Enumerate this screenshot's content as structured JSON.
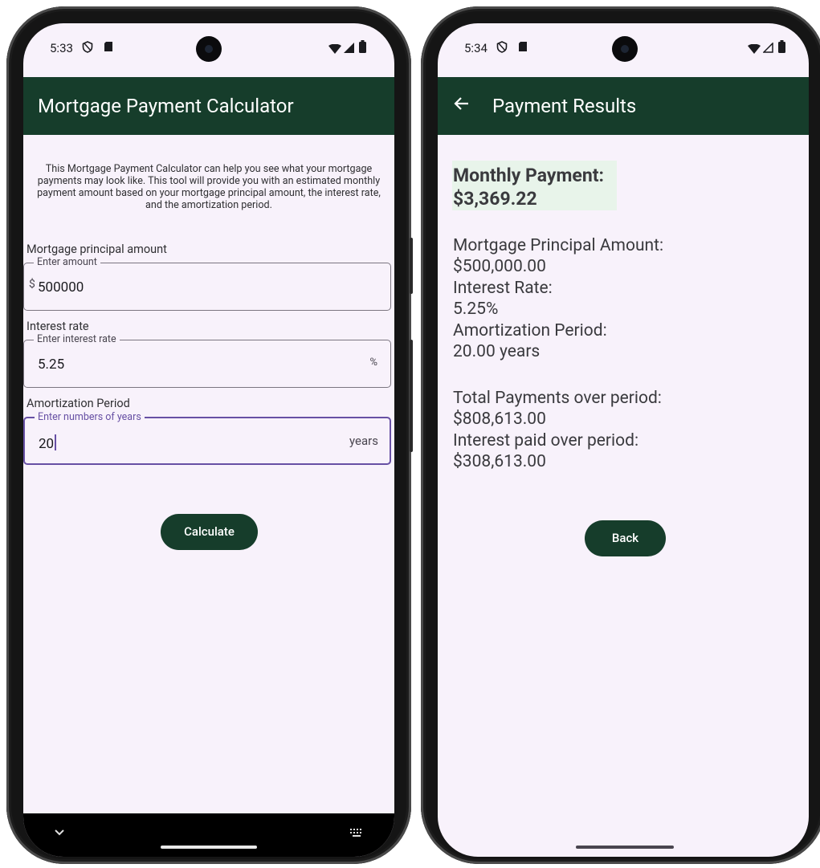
{
  "left_screen": {
    "status": {
      "time": "5:33"
    },
    "appbar_title": "Mortgage Payment Calculator",
    "intro": "This Mortgage Payment Calculator can help you see what your mortgage payments may look like. This tool will provide you with an estimated monthly payment amount based on your mortgage principal amount, the interest rate, and the amortization period.",
    "principal": {
      "label": "Mortgage principal amount",
      "legend": "Enter amount",
      "prefix": "$",
      "value": "500000"
    },
    "interest": {
      "label": "Interest rate",
      "legend": "Enter interest rate",
      "value": "5.25",
      "suffix": "%"
    },
    "amortization": {
      "label": "Amortization Period",
      "legend": "Enter numbers of years",
      "value": "20",
      "suffix": "years"
    },
    "calculate_label": "Calculate",
    "nav": {
      "collapse_icon": "chevron-down-icon",
      "keyboard_icon": "keyboard-icon"
    }
  },
  "right_screen": {
    "status": {
      "time": "5:34"
    },
    "appbar_title": "Payment Results",
    "monthly_label": "Monthly Payment:",
    "monthly_value": "$3,369.22",
    "principal_label": "Mortgage Principal Amount:",
    "principal_value": "$500,000.00",
    "rate_label": "Interest Rate:",
    "rate_value": "5.25%",
    "period_label": "Amortization Period:",
    "period_value": "20.00 years",
    "total_label": "Total Payments over period:",
    "total_value": "$808,613.00",
    "interest_label": "Interest paid over period:",
    "interest_value": "$308,613.00",
    "back_label": "Back"
  },
  "colors": {
    "accent": "#163d2b",
    "focus": "#6750a4",
    "background": "#f8f2fb",
    "highlight": "#e8f4ea"
  }
}
